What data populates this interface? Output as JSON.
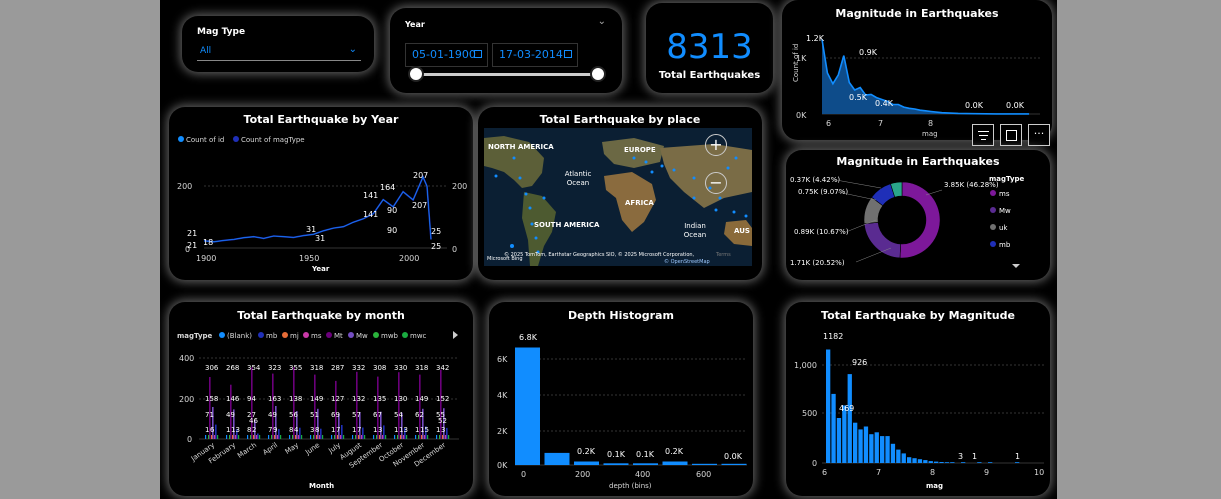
{
  "filters": {
    "magtype_label": "Mag Type",
    "magtype_value": "All",
    "year_label": "Year",
    "date_from": "05-01-1900",
    "date_to": "17-03-2014"
  },
  "kpi": {
    "value": "8313",
    "label": "Total Earthquakes"
  },
  "area_chart": {
    "title": "Magnitude in Earthquakes",
    "ylabel": "Count of id",
    "xlabel": "mag",
    "yticks": [
      "1K",
      "0K"
    ],
    "xticks": [
      "6",
      "7",
      "8",
      "9",
      "10"
    ],
    "labels": [
      "1.2K",
      "0.9K",
      "0.5K",
      "0.4K",
      "0.0K",
      "0.0K"
    ]
  },
  "year_chart": {
    "title": "Total Earthquake by Year",
    "legend": [
      "Count of id",
      "Count of magType"
    ],
    "xlabel": "Year",
    "xticks": [
      "1900",
      "1950",
      "2000"
    ],
    "yticks": [
      "200",
      "0"
    ],
    "yticks_right": [
      "200",
      "0"
    ],
    "labels": [
      "21",
      "21",
      "18",
      "31",
      "31",
      "141",
      "141",
      "164",
      "90",
      "90",
      "207",
      "207",
      "25",
      "25"
    ]
  },
  "map": {
    "title": "Total Earthquake by place",
    "places": [
      "NORTH AMERICA",
      "EUROPE",
      "Atlantic Ocean",
      "AFRICA",
      "SOUTH AMERICA",
      "Indian Ocean",
      "AUS"
    ],
    "attribution": "© 2025 TomTom, Earthstar Geographics SIO, © 2025 Microsoft Corporation,",
    "osm": "© OpenStreetMap",
    "terms": "Terms",
    "bing": "Microsoft Bing"
  },
  "donut": {
    "title": "Magnitude in Earthquakes",
    "legend_title": "magType",
    "legend": [
      "ms",
      "Mw",
      "uk",
      "mb"
    ],
    "labels": [
      "0.37K (4.42%)",
      "0.75K (9.07%)",
      "0.89K (10.67%)",
      "1.71K (20.52%)",
      "3.85K (46.28%)"
    ]
  },
  "month_chart": {
    "title": "Total Earthquake by month",
    "legend_title": "magType",
    "legend": [
      "(Blank)",
      "mb",
      "mj",
      "ms",
      "Mt",
      "Mw",
      "mwb",
      "mwc"
    ],
    "xlabel": "Month",
    "months": [
      "January",
      "February",
      "March",
      "April",
      "May",
      "June",
      "July",
      "August",
      "September",
      "October",
      "November",
      "December"
    ],
    "yticks": [
      "400",
      "200",
      "0"
    ],
    "top": [
      "306",
      "268",
      "354",
      "323",
      "355",
      "318",
      "287",
      "332",
      "308",
      "330",
      "318",
      "342"
    ],
    "mid": [
      "158",
      "146",
      "94",
      "163",
      "138",
      "149",
      "127",
      "132",
      "135",
      "130",
      "149",
      "152"
    ],
    "low": [
      "71",
      "49",
      "27",
      "49",
      "56",
      "51",
      "69",
      "57",
      "67",
      "54",
      "62",
      "55"
    ],
    "low2": [
      "",
      "",
      "46",
      "",
      "",
      "",
      "",
      "",
      "",
      "",
      "",
      "52"
    ],
    "b1": [
      "1",
      "1",
      "8",
      "7",
      "8",
      "3",
      "1",
      "1",
      "1",
      "1",
      "1",
      "1"
    ],
    "b2": [
      "6",
      "13",
      "2",
      "9",
      "4",
      "8",
      "7",
      "7",
      "3",
      "13",
      "15",
      "3"
    ]
  },
  "depth_chart": {
    "title": "Depth Histogram",
    "xlabel": "depth (bins)",
    "xticks": [
      "0",
      "200",
      "400",
      "600"
    ],
    "yticks": [
      "6K",
      "4K",
      "2K",
      "0K"
    ],
    "labels": [
      "6.8K",
      "0.2K",
      "0.1K",
      "0.1K",
      "0.2K",
      "0.0K"
    ]
  },
  "mag_chart": {
    "title": "Total Earthquake by Magnitude",
    "xlabel": "mag",
    "xticks": [
      "6",
      "7",
      "8",
      "9",
      "10"
    ],
    "yticks": [
      "1,000",
      "500",
      "0"
    ],
    "labels": [
      "1182",
      "926",
      "469",
      "3",
      "1",
      "1"
    ]
  },
  "chart_data": [
    {
      "type": "area",
      "title": "Magnitude in Earthquakes",
      "xlabel": "mag",
      "ylabel": "Count of id",
      "x": [
        6.0,
        6.1,
        6.2,
        6.3,
        6.4,
        6.5,
        6.6,
        6.7,
        6.8,
        6.9,
        7.0,
        7.1,
        7.2,
        7.3,
        7.4,
        7.5,
        7.6,
        7.7,
        7.8,
        7.9,
        8.0,
        8.2,
        8.5,
        8.8,
        9.0,
        9.2,
        9.5,
        9.8
      ],
      "y": [
        1182,
        650,
        480,
        620,
        926,
        500,
        380,
        420,
        300,
        310,
        260,
        230,
        200,
        150,
        150,
        110,
        90,
        80,
        60,
        50,
        40,
        20,
        10,
        5,
        3,
        2,
        1,
        1
      ],
      "xlim": [
        6,
        10
      ],
      "ylim": [
        0,
        1300
      ]
    },
    {
      "type": "line",
      "title": "Total Earthquake by Year",
      "xlabel": "Year",
      "x": [
        1900,
        1905,
        1910,
        1915,
        1920,
        1925,
        1930,
        1935,
        1940,
        1945,
        1950,
        1955,
        1960,
        1965,
        1970,
        1975,
        1980,
        1985,
        1990,
        1995,
        2000,
        2005,
        2010,
        2012,
        2014
      ],
      "series": [
        {
          "name": "Count of id",
          "values": [
            21,
            18,
            22,
            25,
            30,
            33,
            28,
            35,
            33,
            31,
            36,
            40,
            50,
            58,
            62,
            75,
            85,
            100,
            141,
            120,
            164,
            140,
            207,
            180,
            25
          ]
        },
        {
          "name": "Count of magType",
          "values": [
            21,
            18,
            22,
            25,
            30,
            33,
            28,
            35,
            33,
            31,
            36,
            40,
            50,
            58,
            62,
            75,
            85,
            100,
            141,
            120,
            164,
            140,
            207,
            180,
            25
          ]
        }
      ],
      "xlim": [
        1900,
        2014
      ],
      "ylim": [
        0,
        230
      ]
    },
    {
      "type": "pie",
      "title": "Magnitude in Earthquakes",
      "categories": [
        "ms",
        "Mw",
        "uk",
        "mb",
        "other"
      ],
      "values": [
        3850,
        1710,
        890,
        750,
        370
      ]
    },
    {
      "type": "bar",
      "title": "Total Earthquake by month",
      "xlabel": "Month",
      "categories": [
        "January",
        "February",
        "March",
        "April",
        "May",
        "June",
        "July",
        "August",
        "September",
        "October",
        "November",
        "December"
      ],
      "series": [
        {
          "name": "ms",
          "values": [
            306,
            268,
            354,
            323,
            355,
            318,
            287,
            332,
            308,
            330,
            318,
            342
          ]
        },
        {
          "name": "Mw",
          "values": [
            158,
            146,
            94,
            163,
            138,
            149,
            127,
            132,
            135,
            130,
            149,
            152
          ]
        },
        {
          "name": "mb",
          "values": [
            71,
            49,
            27,
            49,
            56,
            51,
            69,
            57,
            67,
            54,
            62,
            55
          ]
        }
      ],
      "ylim": [
        0,
        400
      ]
    },
    {
      "type": "bar",
      "title": "Depth Histogram",
      "xlabel": "depth (bins)",
      "categories": [
        "0",
        "100",
        "200",
        "300",
        "400",
        "500",
        "600",
        "700"
      ],
      "values": [
        6800,
        700,
        200,
        100,
        100,
        200,
        50,
        10
      ],
      "ylim": [
        0,
        7000
      ]
    },
    {
      "type": "bar",
      "title": "Total Earthquake by Magnitude",
      "xlabel": "mag",
      "categories": [
        "6.0",
        "6.1",
        "6.2",
        "6.3",
        "6.4",
        "6.5",
        "6.6",
        "6.7",
        "6.8",
        "6.9",
        "7.0",
        "7.1",
        "7.2",
        "7.3",
        "7.4",
        "7.5",
        "7.6",
        "7.7",
        "7.8",
        "7.9",
        "8.0",
        "8.1",
        "8.2",
        "8.3",
        "8.5",
        "8.8",
        "9.0",
        "9.5"
      ],
      "values": [
        1182,
        720,
        469,
        600,
        926,
        420,
        350,
        380,
        300,
        320,
        280,
        280,
        200,
        140,
        100,
        60,
        50,
        40,
        30,
        20,
        15,
        10,
        8,
        6,
        4,
        3,
        3,
        1
      ],
      "ylim": [
        0,
        1250
      ]
    }
  ]
}
